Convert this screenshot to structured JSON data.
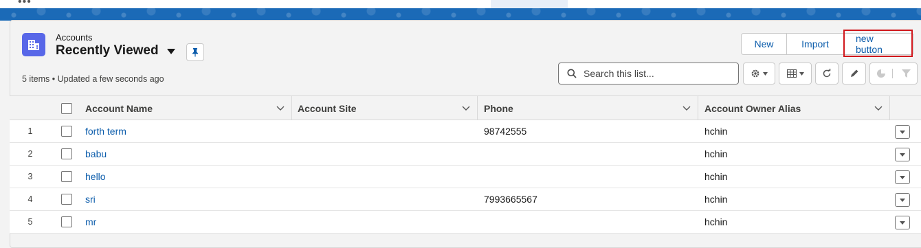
{
  "header": {
    "object_name": "Accounts",
    "list_view_name": "Recently Viewed",
    "status": "5 items • Updated a few seconds ago"
  },
  "actions": {
    "new_label": "New",
    "import_label": "Import",
    "new_button_label": "new button"
  },
  "search": {
    "placeholder": "Search this list..."
  },
  "table": {
    "columns": [
      "Account Name",
      "Account Site",
      "Phone",
      "Account Owner Alias"
    ],
    "rows": [
      {
        "num": "1",
        "name": "forth term",
        "site": "",
        "phone": "98742555",
        "owner": "hchin"
      },
      {
        "num": "2",
        "name": "babu",
        "site": "",
        "phone": "",
        "owner": "hchin"
      },
      {
        "num": "3",
        "name": "hello",
        "site": "",
        "phone": "",
        "owner": "hchin"
      },
      {
        "num": "4",
        "name": "sri",
        "site": "",
        "phone": "7993665567",
        "owner": "hchin"
      },
      {
        "num": "5",
        "name": "mr",
        "site": "",
        "phone": "",
        "owner": "hchin"
      }
    ]
  },
  "icons": {
    "object": "building-icon",
    "pin": "pin-icon",
    "search": "search-icon",
    "settings": "gear-icon",
    "display": "table-icon",
    "refresh": "refresh-icon",
    "edit": "pencil-icon",
    "chart": "pie-chart-icon",
    "filter": "filter-icon"
  },
  "colors": {
    "brand_blue": "#0b5cab",
    "object_icon": "#5867e8",
    "highlight": "#d0161b",
    "banner": "#1b6ab7"
  }
}
